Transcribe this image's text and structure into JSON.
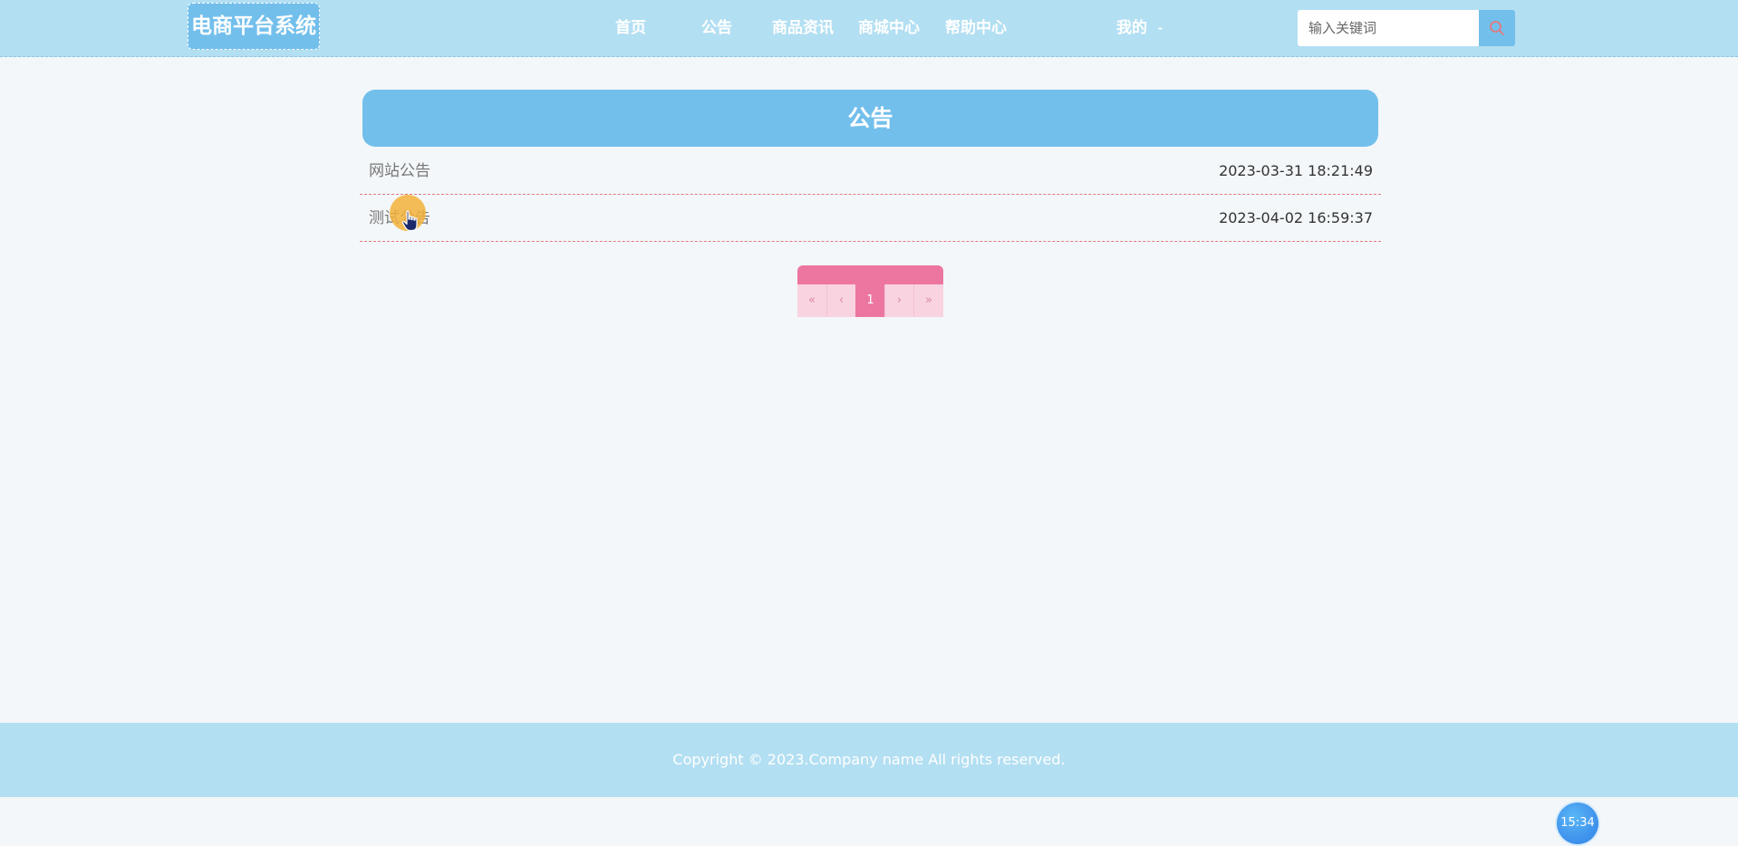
{
  "header": {
    "logo": "电商平台系统",
    "nav": [
      {
        "label": "首页"
      },
      {
        "label": "公告"
      },
      {
        "label": "商品资讯"
      },
      {
        "label": "商城中心"
      },
      {
        "label": "帮助中心"
      }
    ],
    "user_menu": {
      "label": "我的",
      "caret": "-"
    },
    "search": {
      "placeholder": "输入关键词",
      "icon": "search-icon"
    }
  },
  "main": {
    "title": "公告",
    "notices": [
      {
        "title": "网站公告",
        "date": "2023-03-31 18:21:49"
      },
      {
        "title": "测试公告",
        "date": "2023-04-02 16:59:37"
      }
    ],
    "pagination": {
      "first": "«",
      "prev": "‹",
      "current": "1",
      "next": "›",
      "last": "»"
    }
  },
  "footer": {
    "copyright": "Copyright © 2023.Company name All rights reserved."
  },
  "clock": {
    "time": "15:34"
  },
  "colors": {
    "header_bg": "#b3dff2",
    "accent_blue": "#73bfec",
    "accent_pink": "#ec76a0",
    "divider": "#e2797f",
    "page_bg": "#f3f7f9"
  }
}
